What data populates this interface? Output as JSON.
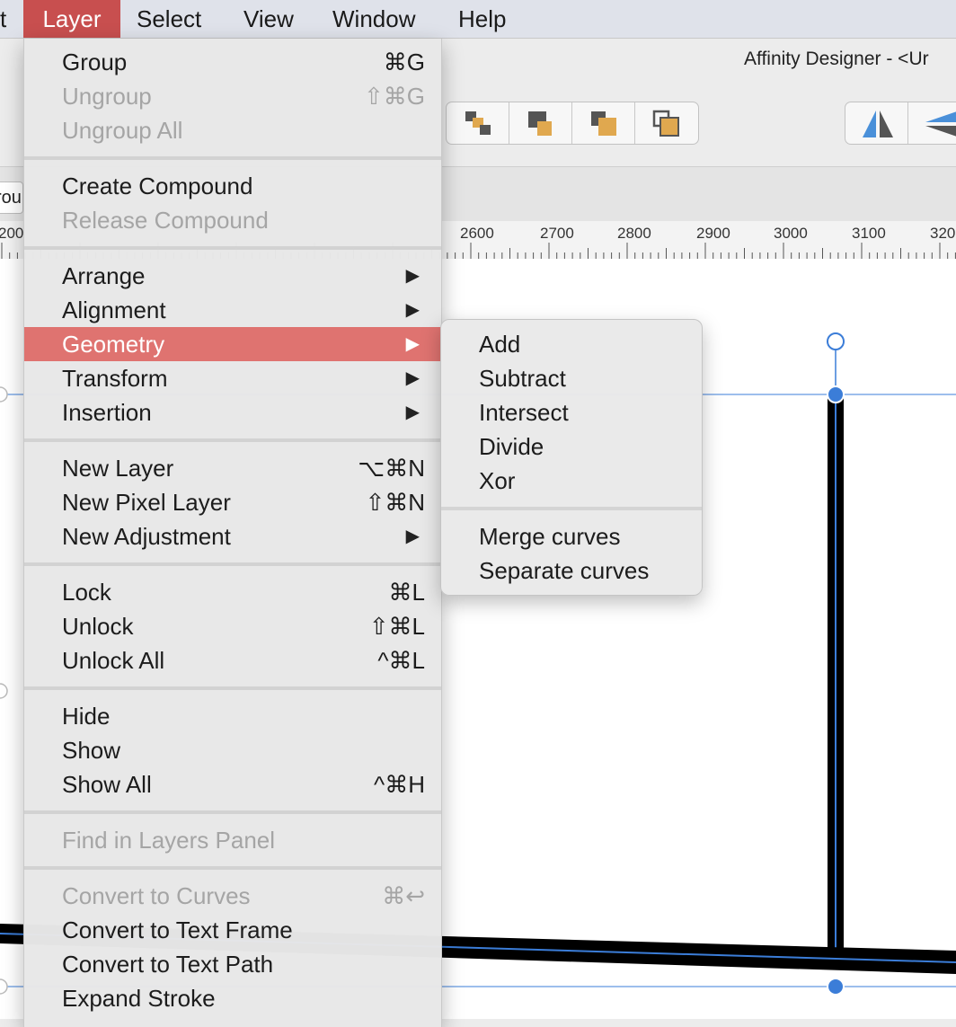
{
  "menubar": {
    "items": [
      {
        "label": "t"
      },
      {
        "label": "Layer"
      },
      {
        "label": "Select"
      },
      {
        "label": "View"
      },
      {
        "label": "Window"
      },
      {
        "label": "Help"
      }
    ]
  },
  "window": {
    "title": "Affinity Designer - <Ur"
  },
  "context_bar": {
    "field_value": "rou"
  },
  "ruler": {
    "labels": [
      "200",
      "2600",
      "2700",
      "2800",
      "2900",
      "3000",
      "3100",
      "320"
    ]
  },
  "layer_menu": {
    "items": [
      {
        "label": "Group",
        "shortcut": "⌘G"
      },
      {
        "label": "Ungroup",
        "shortcut": "⇧⌘G"
      },
      {
        "label": "Ungroup All",
        "shortcut": ""
      },
      {
        "label": "Create Compound",
        "shortcut": ""
      },
      {
        "label": "Release Compound",
        "shortcut": ""
      },
      {
        "label": "Arrange",
        "shortcut": "▶"
      },
      {
        "label": "Alignment",
        "shortcut": "▶"
      },
      {
        "label": "Geometry",
        "shortcut": "▶"
      },
      {
        "label": "Transform",
        "shortcut": "▶"
      },
      {
        "label": "Insertion",
        "shortcut": "▶"
      },
      {
        "label": "New Layer",
        "shortcut": "⌥⌘N"
      },
      {
        "label": "New Pixel Layer",
        "shortcut": "⇧⌘N"
      },
      {
        "label": "New Adjustment",
        "shortcut": "▶"
      },
      {
        "label": "Lock",
        "shortcut": "⌘L"
      },
      {
        "label": "Unlock",
        "shortcut": "⇧⌘L"
      },
      {
        "label": "Unlock All",
        "shortcut": "^⌘L"
      },
      {
        "label": "Hide",
        "shortcut": ""
      },
      {
        "label": "Show",
        "shortcut": ""
      },
      {
        "label": "Show All",
        "shortcut": "^⌘H"
      },
      {
        "label": "Find in Layers Panel",
        "shortcut": ""
      },
      {
        "label": "Convert to Curves",
        "shortcut": "⌘↩"
      },
      {
        "label": "Convert to Text Frame",
        "shortcut": ""
      },
      {
        "label": "Convert to Text Path",
        "shortcut": ""
      },
      {
        "label": "Expand Stroke",
        "shortcut": ""
      }
    ]
  },
  "geometry_submenu": {
    "items": [
      {
        "label": "Add"
      },
      {
        "label": "Subtract"
      },
      {
        "label": "Intersect"
      },
      {
        "label": "Divide"
      },
      {
        "label": "Xor"
      },
      {
        "label": "Merge curves"
      },
      {
        "label": "Separate curves"
      }
    ]
  },
  "colors": {
    "menu_active": "#c84f4f",
    "menu_highlight": "#df7370",
    "selection_blue": "#3b7dd8",
    "toolbar_orange": "#e0a84f"
  }
}
